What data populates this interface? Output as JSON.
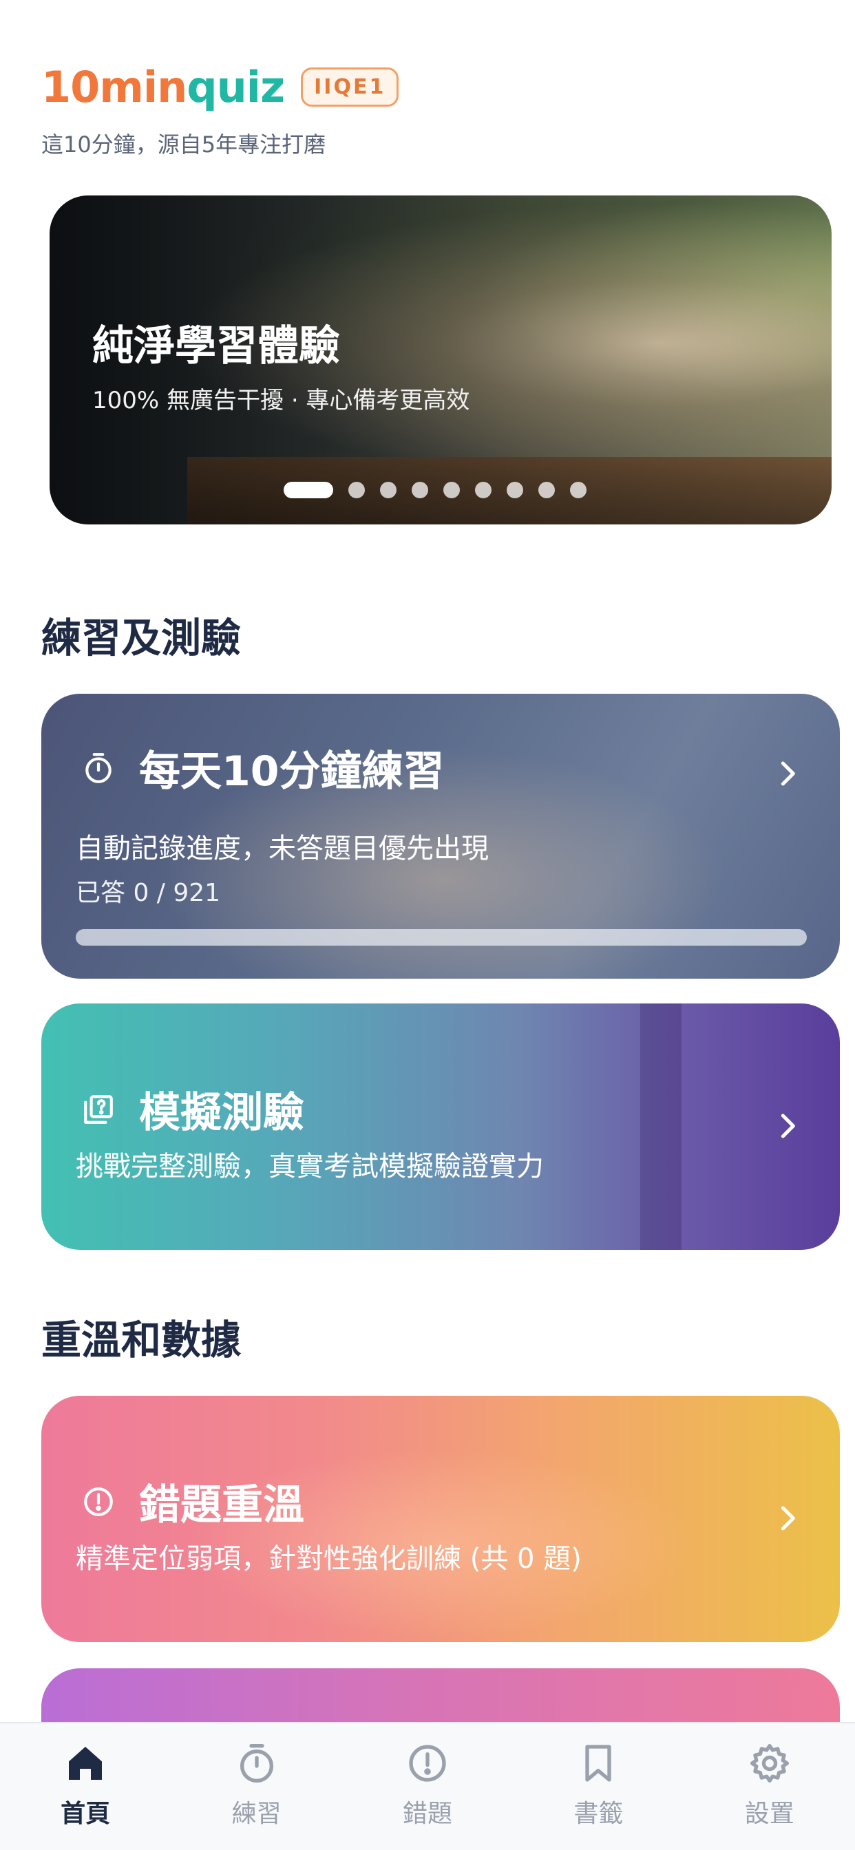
{
  "header": {
    "brand_part1": "10min",
    "brand_part2": "quiz",
    "badge": "IIQE1",
    "tagline": "這10分鐘，源自5年專注打磨"
  },
  "hero": {
    "title": "純淨學習體驗",
    "subtitle": "100% 無廣告干擾 · 專心備考更高效",
    "active_slide": 1,
    "slide_count": 9
  },
  "sections": {
    "practice_title": "練習及測驗",
    "review_title": "重溫和數據"
  },
  "cards": {
    "daily": {
      "title": "每天10分鐘練習",
      "desc": "自動記錄進度，未答題目優先出現",
      "progress_text": "已答 0 / 921",
      "answered": 0,
      "total": 921,
      "icon": "timer-icon"
    },
    "mock": {
      "title": "模擬測驗",
      "desc": "挑戰完整測驗，真實考試模擬驗證實力",
      "icon": "quiz-icon"
    },
    "wrong": {
      "title": "錯題重溫",
      "desc": "精準定位弱項，針對性強化訓練 (共 0 題)",
      "icon": "alert-icon"
    }
  },
  "nav": {
    "home": "首頁",
    "practice": "練習",
    "wrong": "錯題",
    "bookmarks": "書籤",
    "settings": "設置"
  },
  "colors": {
    "brand_orange": "#f2773a",
    "brand_teal": "#20b8a5",
    "nav_active": "#1f2a44",
    "nav_inactive": "#9aa1ad"
  }
}
